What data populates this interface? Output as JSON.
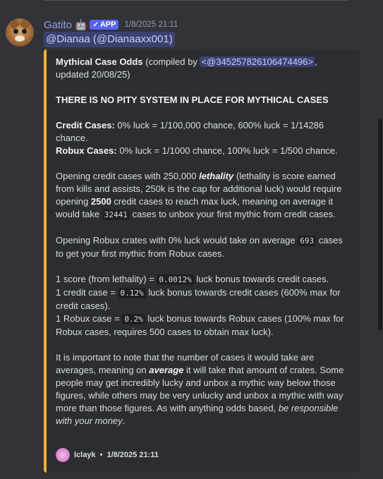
{
  "message": {
    "username": "Gatito",
    "bot_emoji": "🤖",
    "app_badge": "APP",
    "badge_check": "✓",
    "timestamp": "1/8/2025 21:11",
    "mention": "@Dianaa (@Dianaaxx001)"
  },
  "embed": {
    "accent_color": "#f0b232",
    "title": "Mythical Case Odds",
    "compiled_prefix": " (compiled by ",
    "compiled_mention": "<@345257826106474496>",
    "compiled_suffix": ",",
    "updated": "updated 20/08/25)",
    "no_pity": "THERE IS NO PITY SYSTEM IN PLACE FOR MYTHICAL CASES",
    "credit_label": "Credit Cases:",
    "credit_text": " 0% luck = 1/100,000 chance, 600% luck = 1/14286 chance.",
    "robux_label": "Robux Cases:",
    "robux_text": " 0% luck = 1/1000 chance, 100% luck = 1/500 chance.",
    "p3_a": "Opening credit cases with 250,000 ",
    "p3_lethality": "lethality",
    "p3_b": " (lethality is score earned from kills and assists, 250k is the cap for additional luck) would require opening ",
    "p3_2500": "2500",
    "p3_c": " credit cases to reach max luck, meaning on average it would take ",
    "p3_code": "32441",
    "p3_d": " cases to unbox your first mythic from credit cases.",
    "p4_a": "Opening Robux crates with 0% luck would take on average ",
    "p4_code": "693",
    "p4_b": " cases to get your first mythic from Robux cases.",
    "l1_a": "1 score (from lethality) = ",
    "l1_code": "0.0012%",
    "l1_b": " luck bonus towards credit cases.",
    "l2_a": "1 credit case = ",
    "l2_code": "0.12%",
    "l2_b": " luck bonus towards credit cases (600% max for credit cases).",
    "l3_a": "1 Robux case = ",
    "l3_code": "0.2%",
    "l3_b": " luck bonus towards Robux cases (100% max for Robux cases, requires 500 cases to obtain max luck).",
    "p6_a": "It is important to note that the number of cases it would take are averages, meaning on ",
    "p6_average": "average",
    "p6_b": " it will take that amount of crates. Some people may get incredibly lucky and unbox a mythic way below those figures, while others may be very unlucky and unbox a mythic with way more than those figures. As with anything odds based, ",
    "p6_italic": "be responsible with your money",
    "p6_c": ".",
    "footer_author": "lclayk",
    "footer_sep": " • ",
    "footer_time": "1/8/2025 21:11"
  }
}
